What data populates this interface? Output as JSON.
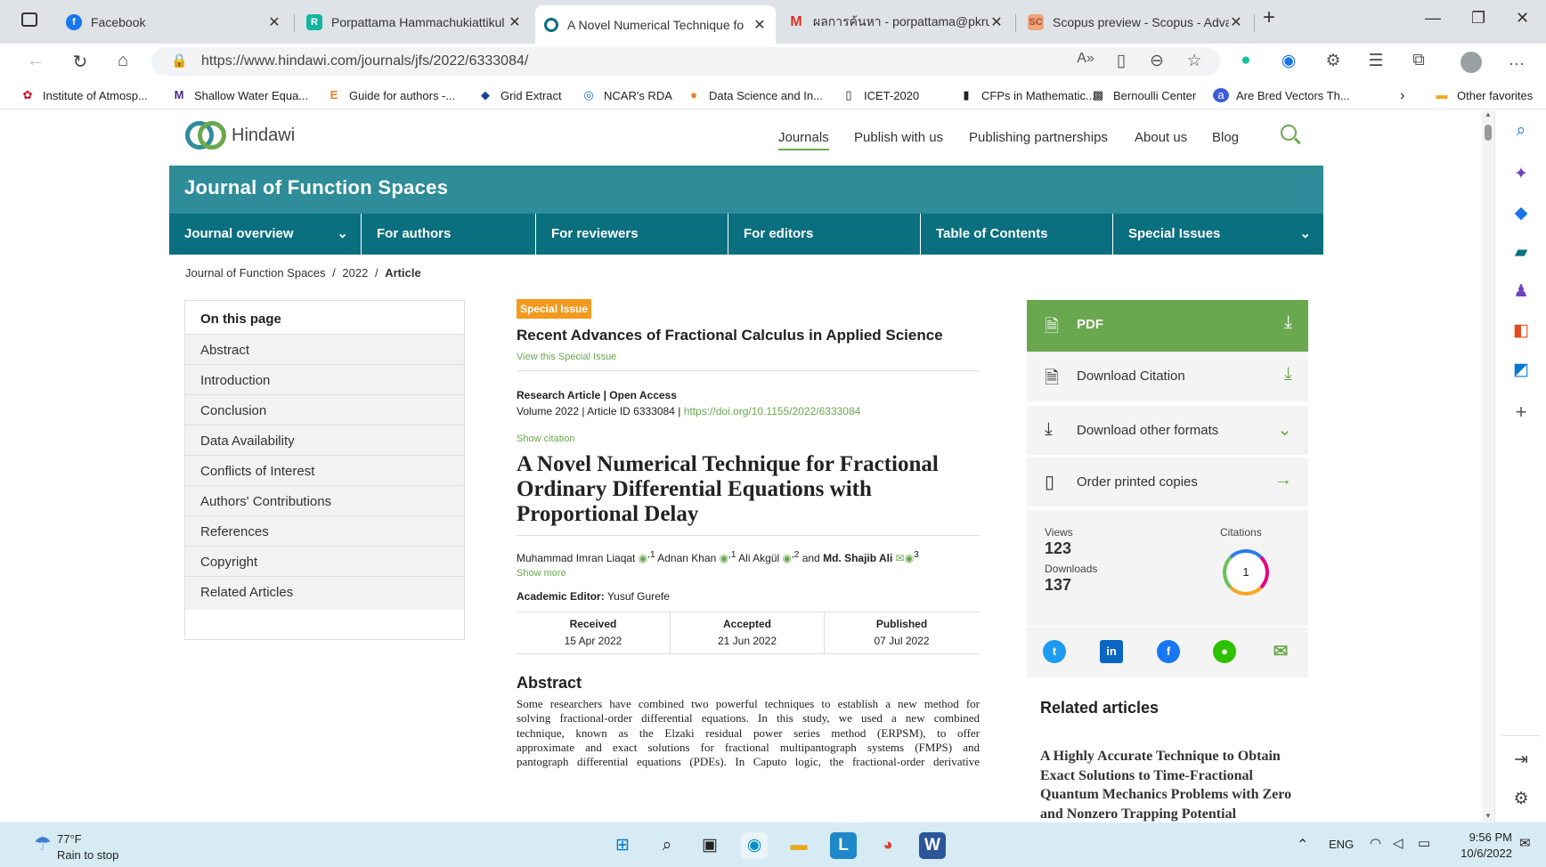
{
  "browser": {
    "tabs": [
      {
        "title": "Facebook",
        "active": false
      },
      {
        "title": "Porpattama Hammachukiattikul |",
        "active": false
      },
      {
        "title": "A Novel Numerical Technique fo",
        "active": true
      },
      {
        "title": "ผลการค้นหา - porpattama@pkru.a",
        "active": false
      },
      {
        "title": "Scopus preview - Scopus - Advar",
        "active": false
      }
    ],
    "url": "https://www.hindawi.com/journals/jfs/2022/6333084/",
    "favorites": [
      "Institute of Atmosp...",
      "Shallow Water Equa...",
      "Guide for authors -...",
      "Grid Extract",
      "NCAR's RDA",
      "Data Science and In...",
      "ICET-2020",
      "CFPs in Mathematic...",
      "Bernoulli Center",
      "Are Bred Vectors Th..."
    ],
    "other_favorites": "Other favorites"
  },
  "site": {
    "logo": "Hindawi",
    "nav": [
      "Journals",
      "Publish with us",
      "Publishing partnerships",
      "About us",
      "Blog"
    ]
  },
  "journal": {
    "title": "Journal of Function Spaces",
    "subnav": [
      "Journal overview",
      "For authors",
      "For reviewers",
      "For editors",
      "Table of Contents",
      "Special Issues"
    ]
  },
  "breadcrumb": {
    "items": [
      "Journal of Function Spaces",
      "2022",
      "Article"
    ]
  },
  "toc": {
    "heading": "On this page",
    "items": [
      "Abstract",
      "Introduction",
      "Conclusion",
      "Data Availability",
      "Conflicts of Interest",
      "Authors' Contributions",
      "References",
      "Copyright",
      "Related Articles"
    ]
  },
  "article": {
    "badge": "Special Issue",
    "special_issue_title": "Recent Advances of Fractional Calculus in Applied Science",
    "view_special": "View this Special Issue",
    "type": "Research Article | Open Access",
    "volume_text": "Volume 2022 | Article ID 6333084 |",
    "doi": "https://doi.org/10.1155/2022/6333084",
    "show_citation": "Show citation",
    "title": "A Novel Numerical Technique for Fractional Ordinary Differential Equations with Proportional Delay",
    "authors": [
      {
        "name": "Muhammad Imran Liaqat",
        "sup": ",1"
      },
      {
        "name": "Adnan Khan",
        "sup": ",1"
      },
      {
        "name": "Ali Akgül",
        "sup": ",2"
      },
      {
        "name": "Md. Shajib Ali",
        "sup": "3"
      }
    ],
    "and": "and",
    "show_more": "Show more",
    "editor_label": "Academic Editor:",
    "editor_name": "Yusuf Gurefe",
    "dates": [
      {
        "label": "Received",
        "value": "15 Apr 2022"
      },
      {
        "label": "Accepted",
        "value": "21 Jun 2022"
      },
      {
        "label": "Published",
        "value": "07 Jul 2022"
      }
    ],
    "abstract_heading": "Abstract",
    "abstract_lines": [
      "Some researchers have combined two powerful techniques to establish a new method for",
      "solving fractional-order differential equations. In this study, we used a new combined",
      "technique, known as the Elzaki residual power series method (ERPSM), to offer",
      "approximate and exact solutions for fractional multipantograph systems (FMPS) and",
      "pantograph differential equations (PDEs). In Caputo logic, the fractional-order derivative"
    ]
  },
  "sidebar": {
    "pdf": "PDF",
    "download_citation": "Download Citation",
    "download_other": "Download other formats",
    "order_print": "Order printed copies",
    "views_label": "Views",
    "views": "123",
    "downloads_label": "Downloads",
    "downloads": "137",
    "citations_label": "Citations",
    "citations": "1",
    "related_heading": "Related articles",
    "related_title": "A Highly Accurate Technique to Obtain Exact Solutions to Time-Fractional Quantum Mechanics Problems with Zero and Nonzero Trapping Potential"
  },
  "taskbar": {
    "temp": "77°F",
    "weather": "Rain to stop",
    "lang": "ENG",
    "time": "9:56 PM",
    "date": "10/6/2022"
  },
  "colors": {
    "teal": "#2f8d99",
    "teal_dark": "#0a6f7e",
    "green": "#6aa84f",
    "orange": "#f39a1e"
  }
}
